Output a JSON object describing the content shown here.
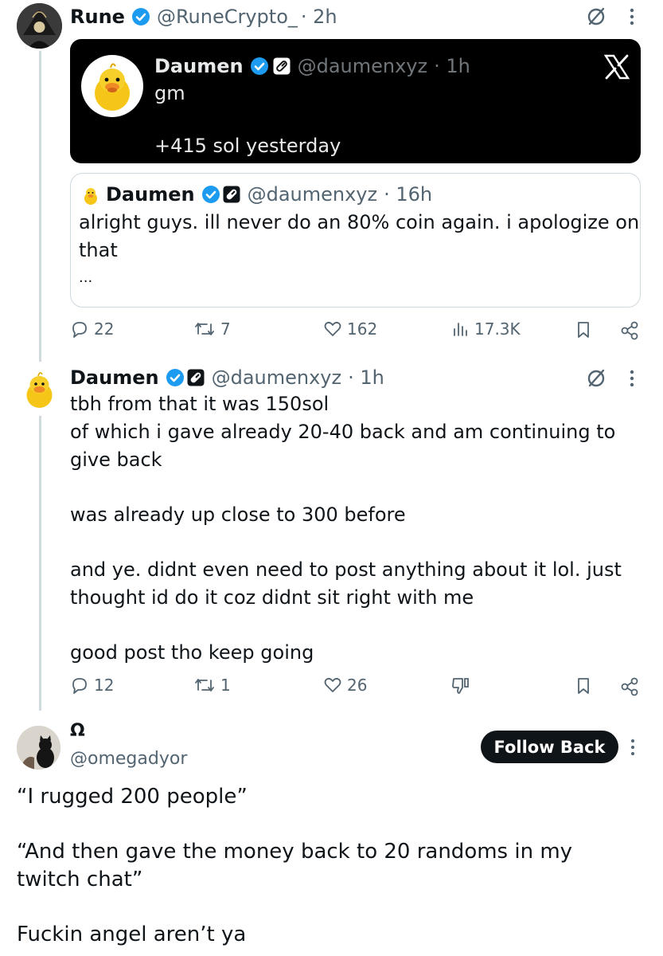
{
  "tweet1": {
    "author_name": "Rune",
    "author_handle": "@RuneCrypto_",
    "time": "· 2h",
    "embed": {
      "author_name": "Daumen",
      "author_handle": "@daumenxyz",
      "time": "· 1h",
      "line1": "gm",
      "line2": "+415 sol yesterday"
    },
    "quote": {
      "author_name": "Daumen",
      "author_handle": "@daumenxyz",
      "time": "· 16h",
      "line1": "alright guys. ill never do an 80% coin again. i apologize on",
      "line2": "that",
      "more": "..."
    },
    "metrics": {
      "replies": "22",
      "reposts": "7",
      "likes": "162",
      "views": "17.3K"
    }
  },
  "tweet2": {
    "author_name": "Daumen",
    "author_handle": "@daumenxyz",
    "time": "· 1h",
    "lines": [
      "tbh from that it was 150sol",
      "of which i gave already 20-40 back and am continuing to",
      "give back",
      "was already up close to 300 before",
      "and ye. didnt even need to post anything about it lol. just",
      "thought id do it coz didnt sit right with me",
      "good post tho keep going"
    ],
    "metrics": {
      "replies": "12",
      "reposts": "1",
      "likes": "26"
    }
  },
  "tweet3": {
    "author_name": "Ω",
    "author_handle": "@omegadyor",
    "follow_label": "Follow Back",
    "lines": [
      "“I rugged 200 people”",
      "“And then gave the money back to 20 randoms in my",
      "twitch chat”",
      "Fuckin angel aren’t ya"
    ]
  },
  "colors": {
    "verified": "#1d9bf0",
    "muted": "#536471",
    "text": "#0f1419",
    "border": "#cfd9de"
  },
  "icons": [
    "verified-badge-icon",
    "pill-badge-icon",
    "grok-icon",
    "more-icon",
    "x-logo-icon",
    "reply-icon",
    "repost-icon",
    "like-icon",
    "views-icon",
    "bookmark-icon",
    "share-icon",
    "dislike-icon"
  ]
}
